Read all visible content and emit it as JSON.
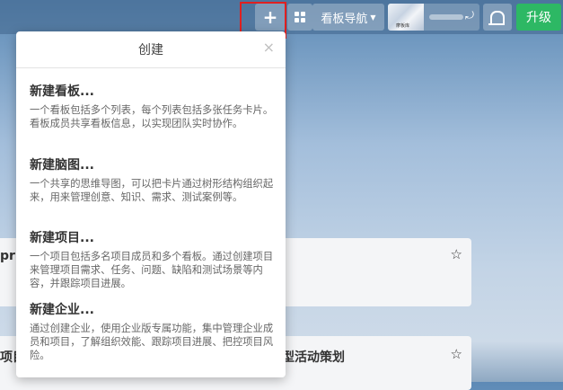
{
  "header": {
    "add_label": "+",
    "board_nav_label": "看板导航",
    "avatar_caption": "摩板库",
    "sync_glyph": "⤾",
    "upgrade_label": "升级"
  },
  "popup": {
    "title": "创建",
    "close_glyph": "×",
    "options": [
      {
        "title": "新建看板...",
        "desc": "一个看板包括多个列表，每个列表包括多张任务卡片。看板成员共享看板信息，以实现团队实时协作。"
      },
      {
        "title": "新建脑图...",
        "desc": "一个共享的思维导图，可以把卡片通过树形结构组织起来，用来管理创意、知识、需求、测试案例等。"
      },
      {
        "title": "新建项目...",
        "desc": "一个项目包括多名项目成员和多个看板。通过创建项目来管理项目需求、任务、问题、缺陷和测试场景等内容，并跟踪项目进展。"
      },
      {
        "title": "新建企业...",
        "desc": "通过创建企业，使用企业版专属功能，集中管理企业成员和项目，了解组织效能、跟踪项目进展、把控项目风险。"
      }
    ]
  },
  "cards": [
    {
      "left_text": "pri",
      "title": "",
      "star": "☆"
    },
    {
      "left_text": "项目",
      "title": "型活动策划",
      "star": "☆"
    }
  ],
  "colors": {
    "highlight": "#e02020",
    "upgrade": "#2db864"
  }
}
